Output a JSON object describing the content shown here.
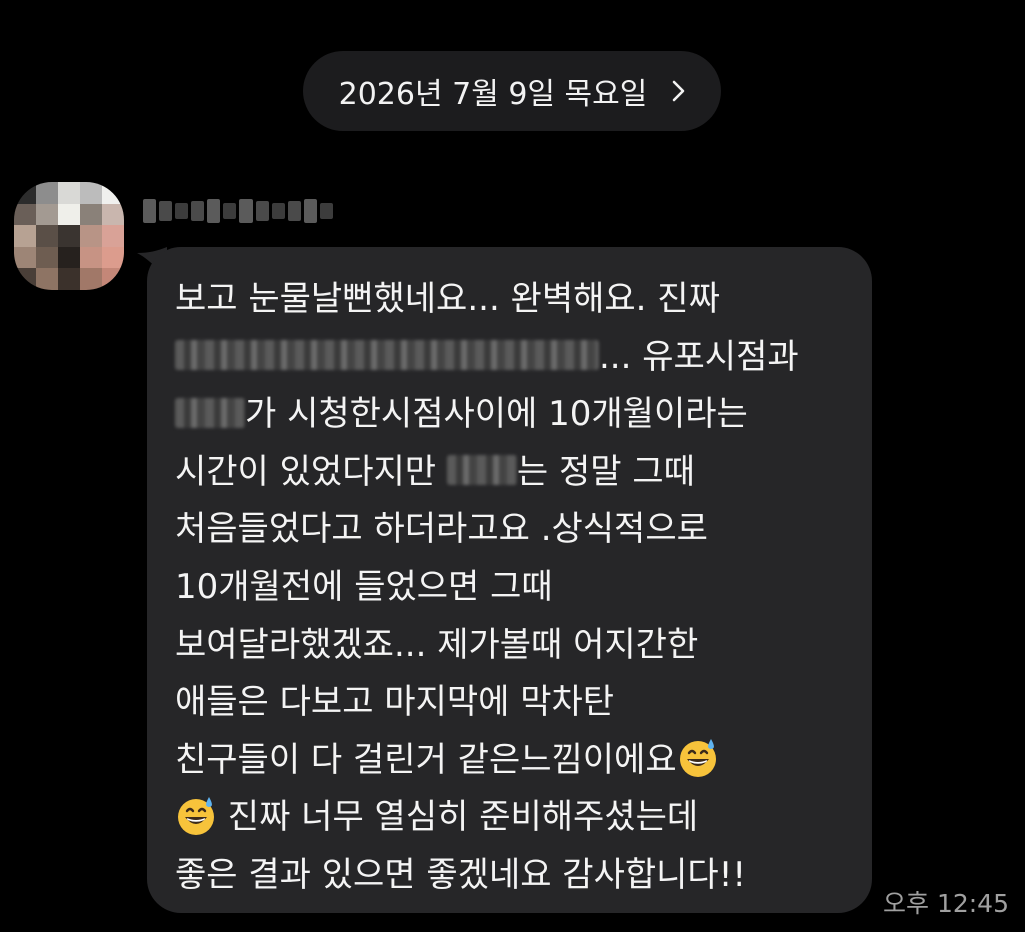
{
  "date_header": {
    "label": "2026년 7월 9일 목요일",
    "chevron_icon": "chevron-right-icon"
  },
  "message": {
    "sender": {
      "avatar_icon": "blurred-avatar",
      "name_redacted": true
    },
    "lines": [
      {
        "pre": " 보고 눈물날뻔했네요... 완벽해요. 진짜",
        "post": ""
      },
      {
        "pre": "",
        "post": "...  유포시점과"
      },
      {
        "pre": "",
        "post": "가 시청한시점사이에 10개월이라는"
      },
      {
        "pre": "시간이 있었다지만 ",
        "post": "는 정말 그때"
      },
      {
        "pre": "처음들었다고 하더라고요 .상식적으로",
        "post": ""
      },
      {
        "pre": "10개월전에 들었으면 그때",
        "post": ""
      },
      {
        "pre": "보여달라했겠죠... 제가볼때 어지간한",
        "post": ""
      },
      {
        "pre": "애들은 다보고 마지막에 막차탄",
        "post": ""
      },
      {
        "pre": "친구들이 다 걸린거 같은느낌이에요",
        "post": ""
      },
      {
        "pre": " 진짜 너무 열심히 준비해주셨는데",
        "post": ""
      },
      {
        "pre": "좋은 결과 있으면 좋겠네요 감사합니다!!",
        "post": ""
      }
    ],
    "emoji_icon": "grinning-face-with-sweat-emoji",
    "timestamp": "오후 12:45"
  },
  "colors": {
    "background": "#000000",
    "bubble": "#262628",
    "date_pill": "#1c1c1e",
    "timestamp": "#a0a0a0"
  }
}
